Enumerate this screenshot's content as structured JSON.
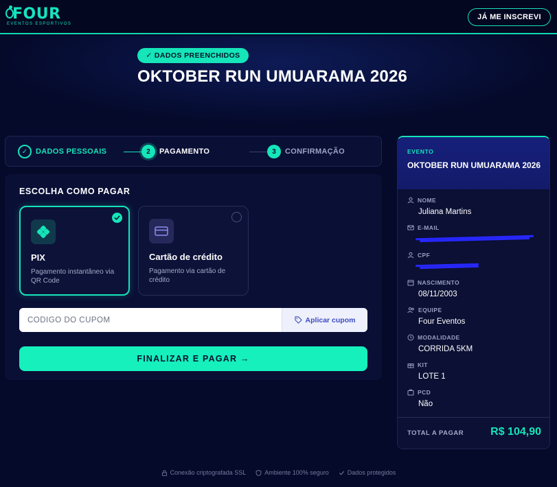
{
  "brand": {
    "logo_text": "FOUR",
    "logo_sub": "EVENTOS ESPORTIVOS"
  },
  "header": {
    "ja_inscrevi": "JÁ ME INSCREVI"
  },
  "hero": {
    "badge": "✓ DADOS PREENCHIDOS",
    "title": "OKTOBER RUN UMUARAMA 2026"
  },
  "stepper": {
    "steps": [
      {
        "num": "✓",
        "label": "DADOS PESSOAIS",
        "state": "done"
      },
      {
        "num": "2",
        "label": "PAGAMENTO",
        "state": "active"
      },
      {
        "num": "3",
        "label": "CONFIRMAÇÃO",
        "state": "pending"
      }
    ]
  },
  "payment": {
    "title": "ESCOLHA COMO PAGAR",
    "options": [
      {
        "name": "PIX",
        "desc": "Pagamento instantâneo via QR Code",
        "selected": true,
        "icon": "pix-icon"
      },
      {
        "name": "Cartão de crédito",
        "desc": "Pagamento via cartão de crédito",
        "selected": false,
        "icon": "credit-card-icon"
      }
    ],
    "coupon_placeholder": "CÓDIGO DO CUPOM",
    "coupon_button": "Aplicar cupom",
    "finalize_button": "FINALIZAR E PAGAR →"
  },
  "summary": {
    "event_label": "EVENTO",
    "event_title": "OKTOBER RUN UMUARAMA 2026",
    "fields": [
      {
        "label": "NOME",
        "value": "Juliana Martins",
        "icon": "user-icon"
      },
      {
        "label": "E-MAIL",
        "value": "",
        "icon": "mail-icon"
      },
      {
        "label": "CPF",
        "value": "",
        "icon": "user-icon"
      },
      {
        "label": "NASCIMENTO",
        "value": "08/11/2003",
        "icon": "calendar-icon"
      },
      {
        "label": "EQUIPE",
        "value": "Four Eventos",
        "icon": "team-icon"
      },
      {
        "label": "MODALIDADE",
        "value": "CORRIDA 5KM",
        "icon": "clock-icon"
      },
      {
        "label": "KIT",
        "value": "LOTE 1",
        "icon": "gift-icon"
      },
      {
        "label": "PCD",
        "value": "Não",
        "icon": "accessibility-icon"
      }
    ],
    "total_label": "TOTAL A PAGAR",
    "total_value": "R$ 104,90"
  },
  "footer": {
    "items": [
      "Conexão criptografada SSL",
      "Ambiente 100% seguro",
      "Dados protegidos"
    ]
  },
  "colors": {
    "accent": "#15e5b9",
    "background": "#050a2b",
    "panel": "#0a0f36"
  }
}
